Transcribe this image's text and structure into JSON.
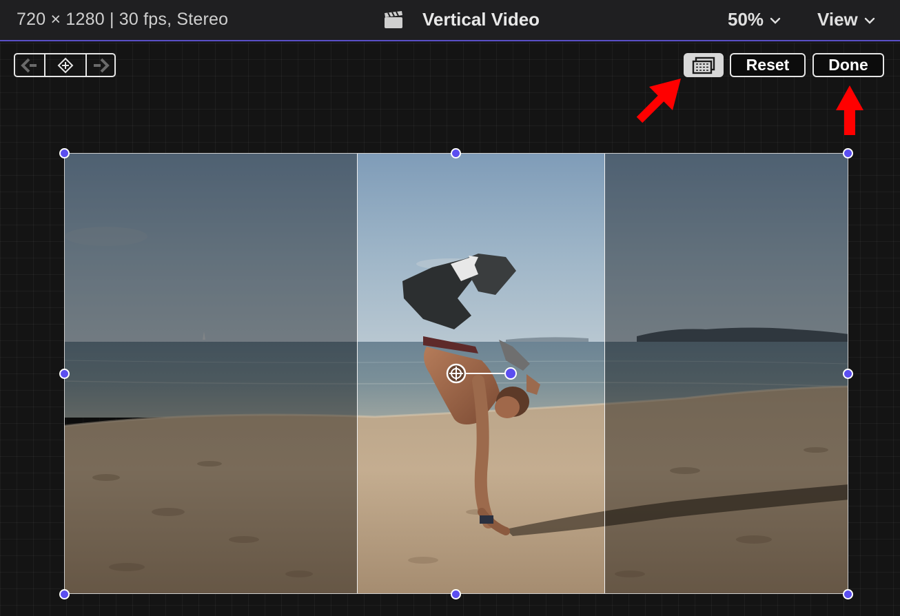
{
  "header": {
    "clip_info": "720 × 1280 | 30 fps, Stereo",
    "project_title": "Vertical Video",
    "zoom_label": "50%",
    "view_label": "View",
    "clapper_icon": "clapperboard-icon"
  },
  "toolbar": {
    "prev_keyframe_icon": "prev-keyframe-icon",
    "add_keyframe_icon": "add-keyframe-icon",
    "next_keyframe_icon": "next-keyframe-icon",
    "aspect_ratio_icon": "aspect-ratio-icon",
    "reset_label": "Reset",
    "done_label": "Done"
  },
  "viewer": {
    "handle_color": "#5b4ef0",
    "annotation_color": "#ff0000",
    "accent_line_color": "#5a50c8"
  }
}
